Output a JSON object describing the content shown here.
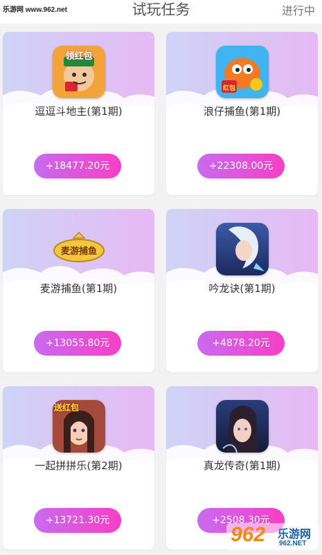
{
  "watermark_top": "乐游网 www.962.net",
  "header": {
    "title": "试玩任务",
    "status_tab": "进行中"
  },
  "tasks": [
    {
      "name": "逗逗斗地主(第1期)",
      "reward": "+18477.20元",
      "icon": "game-icon-doudizhu",
      "icon_text": "领红包"
    },
    {
      "name": "浪仔捕鱼(第1期)",
      "reward": "+22308.00元",
      "icon": "game-icon-fish",
      "icon_text": "红包"
    },
    {
      "name": "麦游捕鱼(第1期)",
      "reward": "+13055.80元",
      "icon": "game-icon-maiyou",
      "icon_text": "麦游捕鱼"
    },
    {
      "name": "吟龙诀(第1期)",
      "reward": "+4878.20元",
      "icon": "game-icon-yinlongjue",
      "icon_text": ""
    },
    {
      "name": "一起拼拼乐(第2期)",
      "reward": "+13721.30元",
      "icon": "game-icon-pinpinle",
      "icon_text": "送红包"
    },
    {
      "name": "真龙传奇(第1期)",
      "reward": "+2508.30元",
      "icon": "game-icon-zhenlong",
      "icon_text": ""
    }
  ],
  "watermark_bottom": {
    "main": "962",
    "cn": "乐游网",
    "en": "962.NET"
  },
  "colors": {
    "button_start": "#c86bf0",
    "button_end": "#f63fc6",
    "card_top": "#d9b8f5",
    "cloud": "#ffffff"
  }
}
